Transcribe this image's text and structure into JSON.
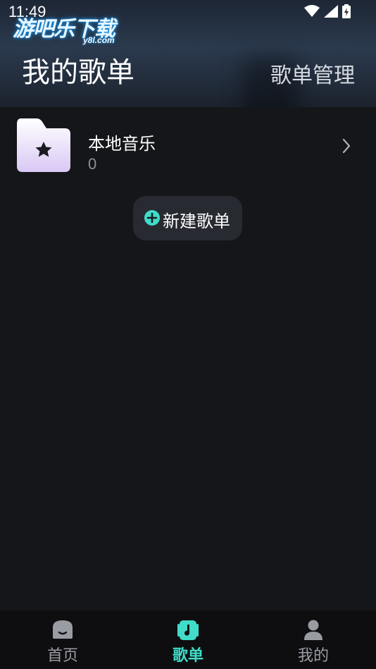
{
  "status_bar": {
    "time": "11:49"
  },
  "watermark": {
    "text": "游吧乐下载",
    "sub": "y8l.com"
  },
  "header": {
    "title": "我的歌单",
    "manage_label": "歌单管理"
  },
  "playlists": [
    {
      "title": "本地音乐",
      "count": "0",
      "icon": "folder-star-icon"
    }
  ],
  "new_playlist": {
    "label": "新建歌单",
    "icon": "plus-circle-icon"
  },
  "tabs": [
    {
      "label": "首页",
      "icon": "home-icon",
      "active": false
    },
    {
      "label": "歌单",
      "icon": "music-playlist-icon",
      "active": true
    },
    {
      "label": "我的",
      "icon": "person-icon",
      "active": false
    }
  ],
  "colors": {
    "accent": "#40dcc8",
    "background": "#151619",
    "button_bg": "#272a31"
  }
}
